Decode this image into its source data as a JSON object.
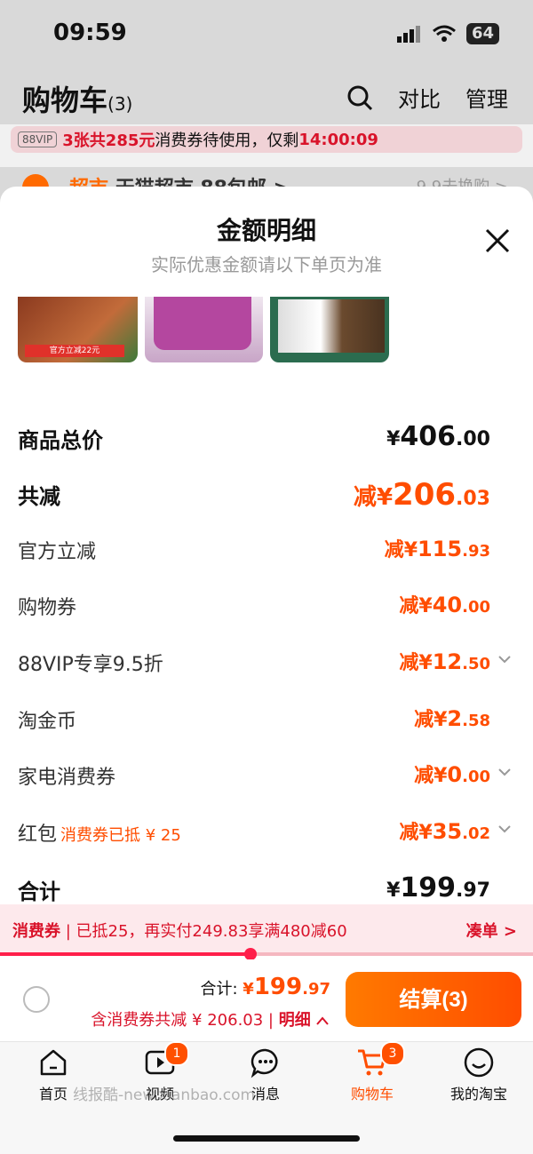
{
  "status_bar": {
    "time": "09:59",
    "battery": "64"
  },
  "cart_header": {
    "title": "购物车",
    "count": "(3)",
    "compare": "对比",
    "manage": "管理"
  },
  "promo_bar": {
    "badge": "88VIP",
    "highlight": "3张共285元",
    "text1": "消费券待使用，仅剩",
    "countdown": "14:00:09"
  },
  "store_row": {
    "tag": "超市",
    "name": "天猫超市 88包邮 >",
    "right": "9.9去换购 >"
  },
  "sheet": {
    "title": "金额明细",
    "subtitle": "实际优惠金额请以下单页为准",
    "thumb1_tag": "官方立减22元"
  },
  "rows": [
    {
      "label": "商品总价",
      "prefix": "",
      "currency": "¥",
      "int": "406",
      "dec": ".00"
    },
    {
      "label": "共减",
      "prefix": "减",
      "currency": "¥",
      "int": "206",
      "dec": ".03"
    },
    {
      "label": "官方立减",
      "prefix": "减",
      "currency": "¥",
      "int": "115",
      "dec": ".93"
    },
    {
      "label": "购物券",
      "prefix": "减",
      "currency": "¥",
      "int": "40",
      "dec": ".00"
    },
    {
      "label": "88VIP专享9.5折",
      "prefix": "减",
      "currency": "¥",
      "int": "12",
      "dec": ".50"
    },
    {
      "label": "淘金币",
      "prefix": "减",
      "currency": "¥",
      "int": "2",
      "dec": ".58"
    },
    {
      "label": "家电消费券",
      "prefix": "减",
      "currency": "¥",
      "int": "0",
      "dec": ".00"
    },
    {
      "label": "红包",
      "tag": "消费券已抵 ¥ 25",
      "prefix": "减",
      "currency": "¥",
      "int": "35",
      "dec": ".02"
    },
    {
      "label": "合计",
      "prefix": "",
      "currency": "¥",
      "int": "199",
      "dec": ".97"
    }
  ],
  "coupon_bar": {
    "label": "消费券",
    "text": "已抵25，再实付249.83享满480减60",
    "link": "凑单 >",
    "progress": 0.47
  },
  "checkout": {
    "total_label": "合计:",
    "total_currency": "¥",
    "total_int": "199",
    "total_dec": ".97",
    "saved_text": "含消费券共减 ¥ 206.03",
    "detail_link": "明细",
    "pay_button": "结算(3)"
  },
  "tabs": [
    {
      "label": "首页"
    },
    {
      "label": "视频",
      "badge": "1"
    },
    {
      "label": "消息"
    },
    {
      "label": "购物车",
      "badge": "3"
    },
    {
      "label": "我的淘宝"
    }
  ],
  "watermark": "线报酷-new.xianbao.com",
  "colors": {
    "accent": "#ff4d00",
    "coupon_red": "#d9132a",
    "pay_gradient_start": "#ff7a00"
  }
}
